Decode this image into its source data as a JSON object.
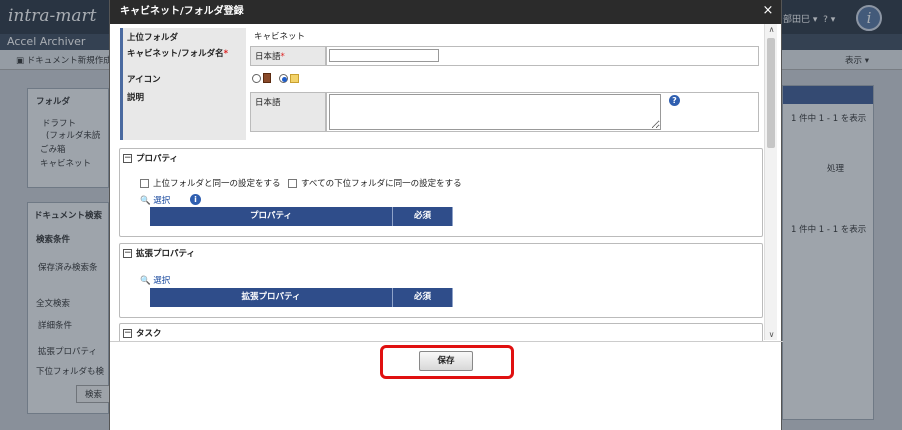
{
  "background": {
    "logo": "intra-mart",
    "app_title": "Accel Archiver",
    "toolbar_doc_label": "ドキュメント新規作成",
    "toolbar_view_label": "表示",
    "user_name": "部田巳",
    "user_help": "?",
    "avatar_letter": "i",
    "folder_panel_title": "フォルダ",
    "folder_items": [
      "ドラフト",
      "(フォルダ未読",
      "ごみ箱",
      "キャビネット"
    ],
    "search_panel_title": "ドキュメント検索",
    "search_condition": "検索条件",
    "saved_search": "保存済み検索条",
    "fulltext": "全文検索",
    "detail_condition": "詳細条件",
    "ext_property": "拡張プロパティ",
    "subfolder": "下位フォルダも検",
    "search_button": "検索",
    "right_count_1": "1 件中 1 - 1 を表示",
    "right_action": "処理",
    "right_count_2": "1 件中 1 - 1 を表示"
  },
  "dialog": {
    "title": "キャビネット/フォルダ登録",
    "close_icon": "×",
    "fields": {
      "parent_folder_label": "上位フォルダ",
      "parent_folder_value": "キャビネット",
      "name_label": "キャビネット/フォルダ名",
      "name_required": "*",
      "name_lang_label": "日本語",
      "name_lang_required": "*",
      "name_value": "",
      "icon_label": "アイコン",
      "icon_selected": "folder",
      "description_label": "説明",
      "description_lang_label": "日本語",
      "description_value": "",
      "help_icon": "?"
    },
    "property_section": {
      "title": "プロパティ",
      "same_as_parent": "上位フォルダと同一の設定をする",
      "same_for_children": "すべての下位フォルダに同一の設定をする",
      "select_link": "選択",
      "info_icon": "i",
      "columns": [
        "プロパティ",
        "必須"
      ]
    },
    "ext_property_section": {
      "title": "拡張プロパティ",
      "select_link": "選択",
      "columns": [
        "拡張プロパティ",
        "必須"
      ]
    },
    "task_section": {
      "title": "タスク"
    },
    "save_button": "保存"
  }
}
